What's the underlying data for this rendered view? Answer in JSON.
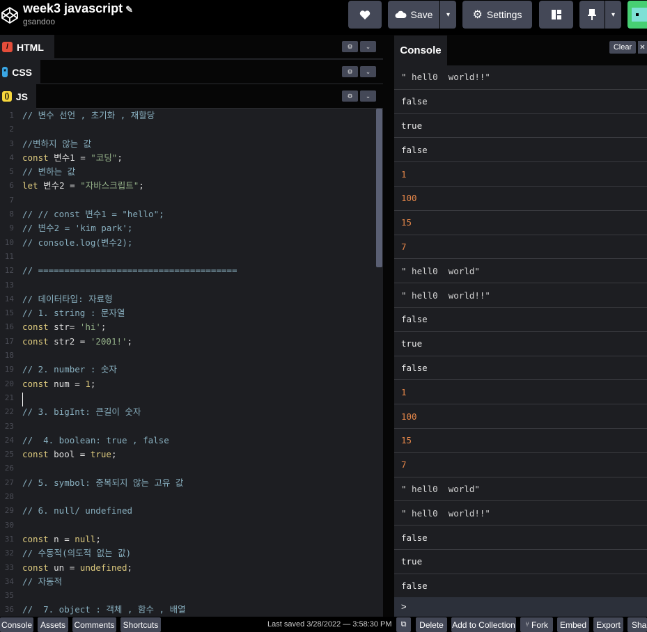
{
  "header": {
    "title": "week3 javascript",
    "author": "gsandoo",
    "save_label": "Save",
    "settings_label": "Settings"
  },
  "editors": {
    "html_label": "HTML",
    "css_label": "CSS",
    "js_label": "JS"
  },
  "code_lines": [
    {
      "n": "1",
      "t": "// 변수 선언 , 초기화 , 재할당",
      "c": "c"
    },
    {
      "n": "2",
      "t": "",
      "c": "pl"
    },
    {
      "n": "3",
      "t": "//변하지 않는 값",
      "c": "c"
    },
    {
      "n": "4",
      "parts": [
        [
          "const ",
          "k"
        ],
        [
          "변수1 = ",
          "pl"
        ],
        [
          "\"코딩\"",
          "s"
        ],
        [
          ";",
          "pl"
        ]
      ]
    },
    {
      "n": "5",
      "t": "// 변하는 값",
      "c": "c"
    },
    {
      "n": "6",
      "parts": [
        [
          "let ",
          "k"
        ],
        [
          "변수2 = ",
          "pl"
        ],
        [
          "\"자바스크립트\"",
          "s"
        ],
        [
          ";",
          "pl"
        ]
      ]
    },
    {
      "n": "7",
      "t": "",
      "c": "pl"
    },
    {
      "n": "8",
      "t": "// // const 변수1 = \"hello\";",
      "c": "c"
    },
    {
      "n": "9",
      "t": "// 변수2 = 'kim park';",
      "c": "c"
    },
    {
      "n": "10",
      "t": "// console.log(변수2);",
      "c": "c"
    },
    {
      "n": "11",
      "t": "",
      "c": "pl"
    },
    {
      "n": "12",
      "t": "// ======================================",
      "c": "c"
    },
    {
      "n": "13",
      "t": "",
      "c": "pl"
    },
    {
      "n": "14",
      "t": "// 데이터타입: 자료형",
      "c": "c"
    },
    {
      "n": "15",
      "t": "// 1. string : 문자열",
      "c": "c"
    },
    {
      "n": "16",
      "parts": [
        [
          "const ",
          "k"
        ],
        [
          "str= ",
          "pl"
        ],
        [
          "'hi'",
          "s"
        ],
        [
          ";",
          "pl"
        ]
      ]
    },
    {
      "n": "17",
      "parts": [
        [
          "const ",
          "k"
        ],
        [
          "str2 = ",
          "pl"
        ],
        [
          "'2001!'",
          "s"
        ],
        [
          ";",
          "pl"
        ]
      ]
    },
    {
      "n": "18",
      "t": "",
      "c": "pl"
    },
    {
      "n": "19",
      "t": "// 2. number : 숫자",
      "c": "c"
    },
    {
      "n": "20",
      "parts": [
        [
          "const ",
          "k"
        ],
        [
          "num = ",
          "pl"
        ],
        [
          "1",
          "n"
        ],
        [
          ";",
          "pl"
        ]
      ]
    },
    {
      "n": "21",
      "t": "",
      "c": "pl"
    },
    {
      "n": "22",
      "t": "// 3. bigInt: 큰길이 숫자",
      "c": "c"
    },
    {
      "n": "23",
      "t": "",
      "c": "pl"
    },
    {
      "n": "24",
      "t": "//  4. boolean: true , false",
      "c": "c"
    },
    {
      "n": "25",
      "parts": [
        [
          "const ",
          "k"
        ],
        [
          "bool = ",
          "pl"
        ],
        [
          "true",
          "k"
        ],
        [
          ";",
          "pl"
        ]
      ]
    },
    {
      "n": "26",
      "t": "",
      "c": "pl"
    },
    {
      "n": "27",
      "t": "// 5. symbol: 중복되지 않는 고유 값",
      "c": "c"
    },
    {
      "n": "28",
      "t": "",
      "c": "pl"
    },
    {
      "n": "29",
      "t": "// 6. null/ undefined",
      "c": "c"
    },
    {
      "n": "30",
      "t": "",
      "c": "pl"
    },
    {
      "n": "31",
      "parts": [
        [
          "const ",
          "k"
        ],
        [
          "n = ",
          "pl"
        ],
        [
          "null",
          "k"
        ],
        [
          ";",
          "pl"
        ]
      ]
    },
    {
      "n": "32",
      "t": "// 수동적(의도적 없는 값)",
      "c": "c"
    },
    {
      "n": "33",
      "parts": [
        [
          "const ",
          "k"
        ],
        [
          "un = ",
          "pl"
        ],
        [
          "undefined",
          "k"
        ],
        [
          ";",
          "pl"
        ]
      ]
    },
    {
      "n": "34",
      "t": "// 자동적",
      "c": "c"
    },
    {
      "n": "35",
      "t": "",
      "c": "pl"
    },
    {
      "n": "36",
      "t": "//  7. object : 객체 , 함수 , 배열",
      "c": "c"
    }
  ],
  "console": {
    "tab_label": "Console",
    "clear_label": "Clear",
    "prompt": ">",
    "rows": [
      {
        "t": "\" hell0  world!!\"",
        "k": "cstr"
      },
      {
        "t": "false",
        "k": "cbool"
      },
      {
        "t": "true",
        "k": "cbool"
      },
      {
        "t": "false",
        "k": "cbool"
      },
      {
        "t": "1",
        "k": "cnum"
      },
      {
        "t": "100",
        "k": "cnum"
      },
      {
        "t": "15",
        "k": "cnum"
      },
      {
        "t": "7",
        "k": "cnum"
      },
      {
        "t": "\" hell0  world\"",
        "k": "cstr"
      },
      {
        "t": "\" hell0  world!!\"",
        "k": "cstr"
      },
      {
        "t": "false",
        "k": "cbool"
      },
      {
        "t": "true",
        "k": "cbool"
      },
      {
        "t": "false",
        "k": "cbool"
      },
      {
        "t": "1",
        "k": "cnum"
      },
      {
        "t": "100",
        "k": "cnum"
      },
      {
        "t": "15",
        "k": "cnum"
      },
      {
        "t": "7",
        "k": "cnum"
      },
      {
        "t": "\" hell0  world\"",
        "k": "cstr"
      },
      {
        "t": "\" hell0  world!!\"",
        "k": "cstr"
      },
      {
        "t": "false",
        "k": "cbool"
      },
      {
        "t": "true",
        "k": "cbool"
      },
      {
        "t": "false",
        "k": "cbool"
      }
    ]
  },
  "footer": {
    "console_label": "Console",
    "assets_label": "Assets",
    "comments_label": "Comments",
    "shortcuts_label": "Shortcuts",
    "last_saved": "Last saved 3/28/2022 — 3:58:30 PM",
    "delete_label": "Delete",
    "add_collection_label": "Add to Collection",
    "fork_label": "Fork",
    "embed_label": "Embed",
    "export_label": "Export",
    "share_label": "Shar"
  },
  "colors": {
    "html_badge": "#e44d3a",
    "css_badge": "#3aa6e4",
    "js_badge": "#f7d73c",
    "keyword": "#ddca7e",
    "string": "#96b38a",
    "comment": "#88afbf",
    "number_output": "#e8884a"
  }
}
